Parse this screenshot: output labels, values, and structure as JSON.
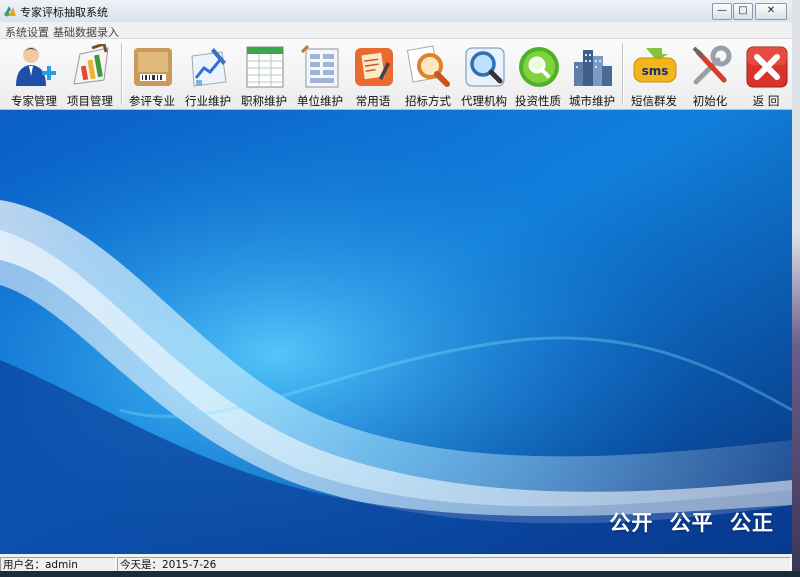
{
  "window": {
    "title": "专家评标抽取系统"
  },
  "window_controls": {
    "minimize": "—",
    "restore": "□",
    "close": "✕"
  },
  "menu": [
    "系统设置",
    "基础数据录入"
  ],
  "toolbar": [
    {
      "label": "专家管理",
      "icon": "expert-user-icon"
    },
    {
      "label": "项目管理",
      "icon": "project-chart-icon"
    },
    {
      "label": "参评专业",
      "icon": "specialty-box-icon"
    },
    {
      "label": "行业维护",
      "icon": "industry-chart-icon"
    },
    {
      "label": "职称维护",
      "icon": "title-sheet-icon"
    },
    {
      "label": "单位维护",
      "icon": "unit-sheet-icon"
    },
    {
      "label": "常用语",
      "icon": "phrase-note-icon"
    },
    {
      "label": "招标方式",
      "icon": "search-magnifier-icon"
    },
    {
      "label": "代理机构",
      "icon": "agency-search-icon"
    },
    {
      "label": "投资性质",
      "icon": "investment-green-search-icon"
    },
    {
      "label": "城市维护",
      "icon": "city-buildings-icon"
    },
    {
      "label": "短信群发",
      "icon": "sms-message-icon"
    },
    {
      "label": "初始化",
      "icon": "tools-wrench-icon"
    },
    {
      "label": "返  回",
      "icon": "close-red-x-icon"
    }
  ],
  "hero": {
    "slogan": "公开 公平 公正"
  },
  "status": {
    "user": "用户名：admin",
    "date": "今天是：2015-7-26"
  },
  "colors": {
    "accent": "#0a5fc4",
    "close": "#d9342b",
    "sms": "#7bb12a"
  }
}
